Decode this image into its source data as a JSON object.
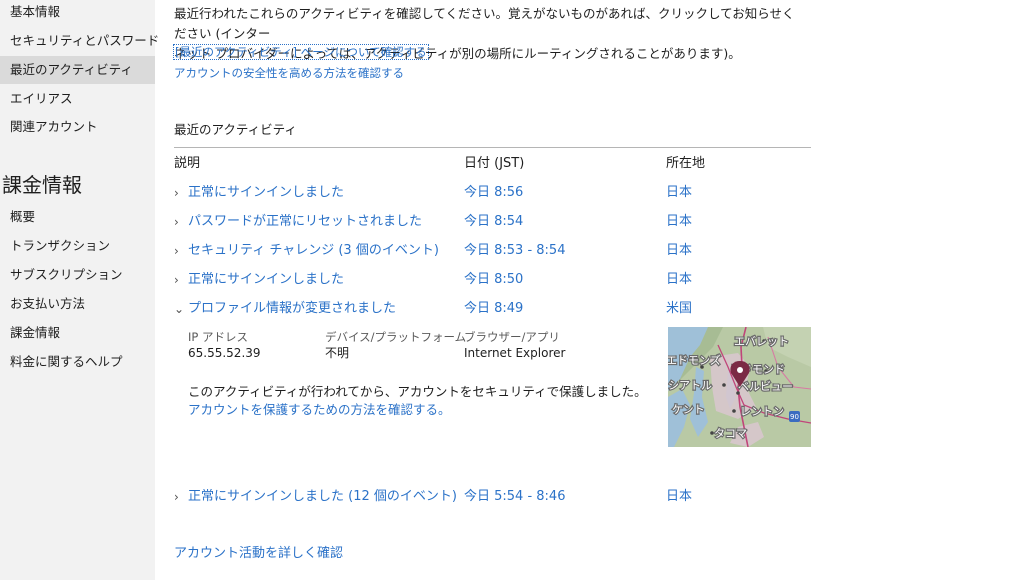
{
  "sidebar": {
    "account_items": [
      {
        "label": "基本情報"
      },
      {
        "label": "セキュリティとパスワード"
      },
      {
        "label": "最近のアクティビティ"
      },
      {
        "label": "エイリアス"
      },
      {
        "label": "関連アカウント"
      }
    ],
    "billing_heading": "課金情報",
    "billing_items": [
      {
        "label": "概要"
      },
      {
        "label": "トランザクション"
      },
      {
        "label": "サブスクリプション"
      },
      {
        "label": "お支払い方法"
      },
      {
        "label": "課金情報"
      },
      {
        "label": "料金に関するヘルプ"
      }
    ]
  },
  "main": {
    "intro_line1": "最近行われたこれらのアクティビティを確認してください。覚えがないものがあれば、クリックしてお知らせください (インター",
    "intro_line2": "ネット プロバイダーによっては、アクティビティが別の場所にルーティングされることがあります)。",
    "link_about_page": "[最近のアクティビティ] ページについて確認する",
    "link_security_tips": "アカウントの安全性を高める方法を確認する",
    "section_title": "最近のアクティビティ",
    "columns": {
      "description": "説明",
      "date": "日付 (JST)",
      "location": "所在地"
    },
    "activities": [
      {
        "description": "正常にサインインしました",
        "date": "今日 8:56",
        "location": "日本"
      },
      {
        "description": "パスワードが正常にリセットされました",
        "date": "今日 8:54",
        "location": "日本"
      },
      {
        "description": "セキュリティ チャレンジ (3 個のイベント)",
        "date": "今日 8:53 - 8:54",
        "location": "日本"
      },
      {
        "description": "正常にサインインしました",
        "date": "今日 8:50",
        "location": "日本"
      },
      {
        "description": "プロファイル情報が変更されました",
        "date": "今日 8:49",
        "location": "米国"
      }
    ],
    "expanded_detail": {
      "ip_label": "IP アドレス",
      "ip_value": "65.55.52.39",
      "device_label": "デバイス/プラットフォーム",
      "device_value": "不明",
      "browser_label": "ブラウザー/アプリ",
      "browser_value": "Internet Explorer",
      "note": "このアクティビティが行われてから、アカウントをセキュリティで保護しました。",
      "note_link": "アカウントを保護するための方法を確認する。",
      "map_labels": {
        "everett": "エバレット",
        "edmonds": "エドモンズ",
        "redmond": "レドモンド",
        "seattle": "シアトル",
        "bellevue": "ベルビュー",
        "renton": "レントン",
        "kent": "ケント",
        "tacoma": "タコマ",
        "highway": "90"
      }
    },
    "last_activity": {
      "description": "正常にサインインしました (12 個のイベント)",
      "date": "今日 5:54 - 8:46",
      "location": "日本"
    },
    "footer_link": "アカウント活動を詳しく確認"
  },
  "colors": {
    "link": "#2b72c8",
    "sidebar_bg": "#f2f2f2",
    "sidebar_active": "#dadada",
    "map_pin": "#7b2a45"
  },
  "icons": {
    "collapsed": "chevron-right-icon",
    "expanded": "chevron-down-icon",
    "map_pin": "map-pin-icon"
  }
}
